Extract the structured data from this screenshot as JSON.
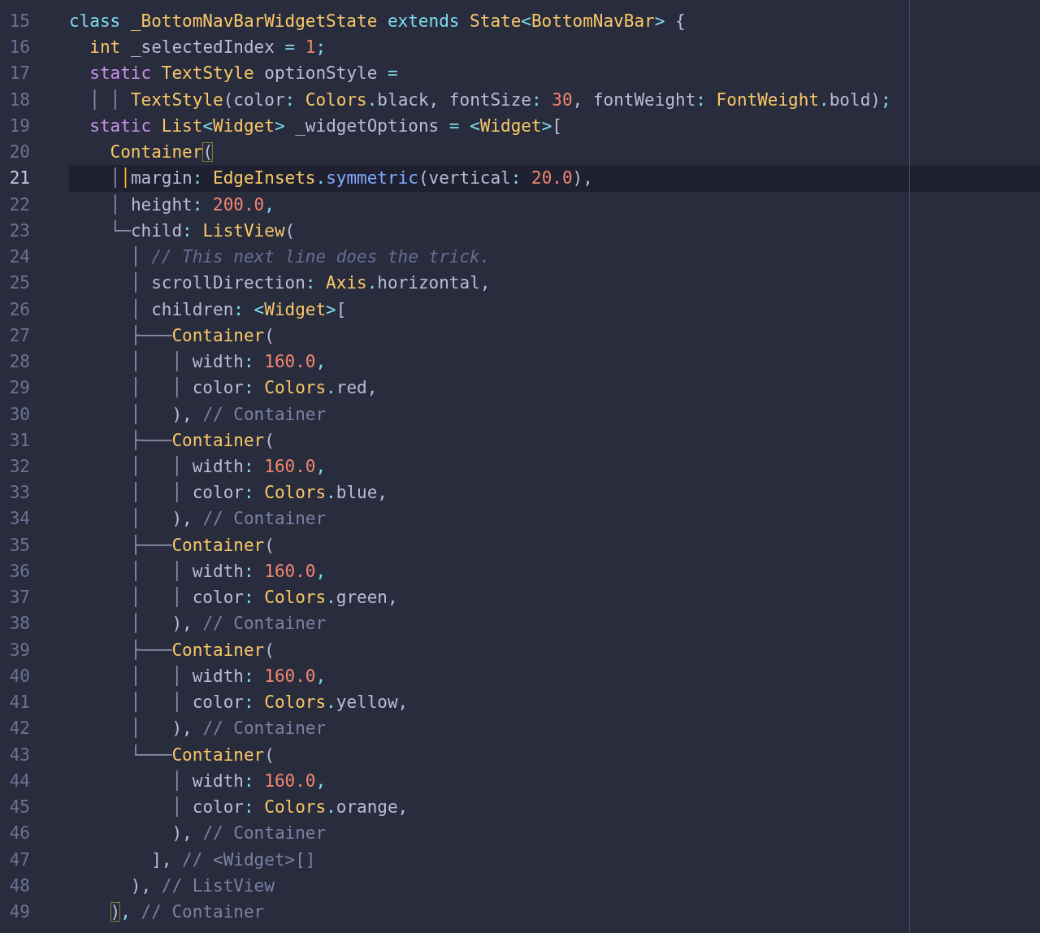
{
  "editor": {
    "lines": [
      {
        "number": "15",
        "current": false,
        "tokens": [
          {
            "text": "class ",
            "kind": "kw"
          },
          {
            "text": "_BottomNavBarWidgetState ",
            "kind": "type"
          },
          {
            "text": "extends ",
            "kind": "kw"
          },
          {
            "text": "State",
            "kind": "type"
          },
          {
            "text": "<",
            "kind": "punct"
          },
          {
            "text": "BottomNavBar",
            "kind": "type"
          },
          {
            "text": "> ",
            "kind": "punct"
          },
          {
            "text": "{",
            "kind": "plain"
          }
        ]
      },
      {
        "number": "16",
        "current": false,
        "tokens": [
          {
            "text": "  int ",
            "kind": "type"
          },
          {
            "text": "_selectedIndex ",
            "kind": "plain"
          },
          {
            "text": "= ",
            "kind": "punct"
          },
          {
            "text": "1",
            "kind": "num"
          },
          {
            "text": ";",
            "kind": "punct"
          }
        ]
      },
      {
        "number": "17",
        "current": false,
        "tokens": [
          {
            "text": "  static ",
            "kind": "storage"
          },
          {
            "text": "TextStyle ",
            "kind": "type"
          },
          {
            "text": "optionStyle ",
            "kind": "plain"
          },
          {
            "text": "=",
            "kind": "punct"
          }
        ]
      },
      {
        "number": "18",
        "current": false,
        "tokens": [
          {
            "text": "  │ │ ",
            "kind": "guide"
          },
          {
            "text": "TextStyle",
            "kind": "type"
          },
          {
            "text": "(color",
            "kind": "plain"
          },
          {
            "text": ": ",
            "kind": "punct"
          },
          {
            "text": "Colors",
            "kind": "type"
          },
          {
            "text": ".",
            "kind": "punct"
          },
          {
            "text": "black, fontSize",
            "kind": "plain"
          },
          {
            "text": ": ",
            "kind": "punct"
          },
          {
            "text": "30",
            "kind": "num"
          },
          {
            "text": ", fontWeight",
            "kind": "plain"
          },
          {
            "text": ": ",
            "kind": "punct"
          },
          {
            "text": "FontWeight",
            "kind": "type"
          },
          {
            "text": ".",
            "kind": "punct"
          },
          {
            "text": "bold)",
            "kind": "plain"
          },
          {
            "text": ";",
            "kind": "punct"
          }
        ]
      },
      {
        "number": "19",
        "current": false,
        "tokens": [
          {
            "text": "  static ",
            "kind": "storage"
          },
          {
            "text": "List",
            "kind": "type"
          },
          {
            "text": "<",
            "kind": "punct"
          },
          {
            "text": "Widget",
            "kind": "type"
          },
          {
            "text": "> ",
            "kind": "punct"
          },
          {
            "text": "_widgetOptions ",
            "kind": "plain"
          },
          {
            "text": "= <",
            "kind": "punct"
          },
          {
            "text": "Widget",
            "kind": "type"
          },
          {
            "text": ">",
            "kind": "punct"
          },
          {
            "text": "[",
            "kind": "plain"
          }
        ]
      },
      {
        "number": "20",
        "current": false,
        "tokens": [
          {
            "text": "    Container",
            "kind": "type"
          },
          {
            "text": "(",
            "kind": "match"
          }
        ]
      },
      {
        "number": "21",
        "current": true,
        "tokens": [
          {
            "text": "    │",
            "kind": "guide"
          },
          {
            "text": "│",
            "kind": "active"
          },
          {
            "text": "margin",
            "kind": "plain"
          },
          {
            "text": ": ",
            "kind": "punct"
          },
          {
            "text": "EdgeInsets",
            "kind": "type"
          },
          {
            "text": ".",
            "kind": "punct"
          },
          {
            "text": "symmetric",
            "kind": "func"
          },
          {
            "text": "(vertical",
            "kind": "plain"
          },
          {
            "text": ": ",
            "kind": "punct"
          },
          {
            "text": "20.0",
            "kind": "num"
          },
          {
            "text": "),",
            "kind": "plain"
          }
        ]
      },
      {
        "number": "22",
        "current": false,
        "tokens": [
          {
            "text": "    │ ",
            "kind": "guide"
          },
          {
            "text": "height",
            "kind": "plain"
          },
          {
            "text": ": ",
            "kind": "punct"
          },
          {
            "text": "200.0",
            "kind": "num"
          },
          {
            "text": ",",
            "kind": "punct"
          }
        ]
      },
      {
        "number": "23",
        "current": false,
        "tokens": [
          {
            "text": "    └─",
            "kind": "guide"
          },
          {
            "text": "child",
            "kind": "plain"
          },
          {
            "text": ": ",
            "kind": "punct"
          },
          {
            "text": "ListView",
            "kind": "type"
          },
          {
            "text": "(",
            "kind": "plain"
          }
        ]
      },
      {
        "number": "24",
        "current": false,
        "tokens": [
          {
            "text": "      │ ",
            "kind": "guide"
          },
          {
            "text": "// This next line does the trick.",
            "kind": "doc"
          }
        ]
      },
      {
        "number": "25",
        "current": false,
        "tokens": [
          {
            "text": "      │ ",
            "kind": "guide"
          },
          {
            "text": "scrollDirection",
            "kind": "plain"
          },
          {
            "text": ": ",
            "kind": "punct"
          },
          {
            "text": "Axis",
            "kind": "type"
          },
          {
            "text": ".",
            "kind": "punct"
          },
          {
            "text": "horizontal,",
            "kind": "plain"
          }
        ]
      },
      {
        "number": "26",
        "current": false,
        "tokens": [
          {
            "text": "      │ ",
            "kind": "guide"
          },
          {
            "text": "children",
            "kind": "plain"
          },
          {
            "text": ": <",
            "kind": "punct"
          },
          {
            "text": "Widget",
            "kind": "type"
          },
          {
            "text": ">",
            "kind": "punct"
          },
          {
            "text": "[",
            "kind": "plain"
          }
        ]
      },
      {
        "number": "27",
        "current": false,
        "tokens": [
          {
            "text": "      ├───",
            "kind": "guide"
          },
          {
            "text": "Container",
            "kind": "type"
          },
          {
            "text": "(",
            "kind": "plain"
          }
        ]
      },
      {
        "number": "28",
        "current": false,
        "tokens": [
          {
            "text": "      │   │ ",
            "kind": "guide"
          },
          {
            "text": "width",
            "kind": "plain"
          },
          {
            "text": ": ",
            "kind": "punct"
          },
          {
            "text": "160.0",
            "kind": "num"
          },
          {
            "text": ",",
            "kind": "punct"
          }
        ]
      },
      {
        "number": "29",
        "current": false,
        "tokens": [
          {
            "text": "      │   │ ",
            "kind": "guide"
          },
          {
            "text": "color",
            "kind": "plain"
          },
          {
            "text": ": ",
            "kind": "punct"
          },
          {
            "text": "Colors",
            "kind": "type"
          },
          {
            "text": ".",
            "kind": "punct"
          },
          {
            "text": "red,",
            "kind": "plain"
          }
        ]
      },
      {
        "number": "30",
        "current": false,
        "tokens": [
          {
            "text": "      │   ",
            "kind": "guide"
          },
          {
            "text": "), ",
            "kind": "plain"
          },
          {
            "text": "// Container",
            "kind": "comment"
          }
        ]
      },
      {
        "number": "31",
        "current": false,
        "tokens": [
          {
            "text": "      ├───",
            "kind": "guide"
          },
          {
            "text": "Container",
            "kind": "type"
          },
          {
            "text": "(",
            "kind": "plain"
          }
        ]
      },
      {
        "number": "32",
        "current": false,
        "tokens": [
          {
            "text": "      │   │ ",
            "kind": "guide"
          },
          {
            "text": "width",
            "kind": "plain"
          },
          {
            "text": ": ",
            "kind": "punct"
          },
          {
            "text": "160.0",
            "kind": "num"
          },
          {
            "text": ",",
            "kind": "punct"
          }
        ]
      },
      {
        "number": "33",
        "current": false,
        "tokens": [
          {
            "text": "      │   │ ",
            "kind": "guide"
          },
          {
            "text": "color",
            "kind": "plain"
          },
          {
            "text": ": ",
            "kind": "punct"
          },
          {
            "text": "Colors",
            "kind": "type"
          },
          {
            "text": ".",
            "kind": "punct"
          },
          {
            "text": "blue,",
            "kind": "plain"
          }
        ]
      },
      {
        "number": "34",
        "current": false,
        "tokens": [
          {
            "text": "      │   ",
            "kind": "guide"
          },
          {
            "text": "), ",
            "kind": "plain"
          },
          {
            "text": "// Container",
            "kind": "comment"
          }
        ]
      },
      {
        "number": "35",
        "current": false,
        "tokens": [
          {
            "text": "      ├───",
            "kind": "guide"
          },
          {
            "text": "Container",
            "kind": "type"
          },
          {
            "text": "(",
            "kind": "plain"
          }
        ]
      },
      {
        "number": "36",
        "current": false,
        "tokens": [
          {
            "text": "      │   │ ",
            "kind": "guide"
          },
          {
            "text": "width",
            "kind": "plain"
          },
          {
            "text": ": ",
            "kind": "punct"
          },
          {
            "text": "160.0",
            "kind": "num"
          },
          {
            "text": ",",
            "kind": "punct"
          }
        ]
      },
      {
        "number": "37",
        "current": false,
        "tokens": [
          {
            "text": "      │   │ ",
            "kind": "guide"
          },
          {
            "text": "color",
            "kind": "plain"
          },
          {
            "text": ": ",
            "kind": "punct"
          },
          {
            "text": "Colors",
            "kind": "type"
          },
          {
            "text": ".",
            "kind": "punct"
          },
          {
            "text": "green,",
            "kind": "plain"
          }
        ]
      },
      {
        "number": "38",
        "current": false,
        "tokens": [
          {
            "text": "      │   ",
            "kind": "guide"
          },
          {
            "text": "), ",
            "kind": "plain"
          },
          {
            "text": "// Container",
            "kind": "comment"
          }
        ]
      },
      {
        "number": "39",
        "current": false,
        "tokens": [
          {
            "text": "      ├───",
            "kind": "guide"
          },
          {
            "text": "Container",
            "kind": "type"
          },
          {
            "text": "(",
            "kind": "plain"
          }
        ]
      },
      {
        "number": "40",
        "current": false,
        "tokens": [
          {
            "text": "      │   │ ",
            "kind": "guide"
          },
          {
            "text": "width",
            "kind": "plain"
          },
          {
            "text": ": ",
            "kind": "punct"
          },
          {
            "text": "160.0",
            "kind": "num"
          },
          {
            "text": ",",
            "kind": "punct"
          }
        ]
      },
      {
        "number": "41",
        "current": false,
        "tokens": [
          {
            "text": "      │   │ ",
            "kind": "guide"
          },
          {
            "text": "color",
            "kind": "plain"
          },
          {
            "text": ": ",
            "kind": "punct"
          },
          {
            "text": "Colors",
            "kind": "type"
          },
          {
            "text": ".",
            "kind": "punct"
          },
          {
            "text": "yellow,",
            "kind": "plain"
          }
        ]
      },
      {
        "number": "42",
        "current": false,
        "tokens": [
          {
            "text": "      │   ",
            "kind": "guide"
          },
          {
            "text": "), ",
            "kind": "plain"
          },
          {
            "text": "// Container",
            "kind": "comment"
          }
        ]
      },
      {
        "number": "43",
        "current": false,
        "tokens": [
          {
            "text": "      └───",
            "kind": "guide"
          },
          {
            "text": "Container",
            "kind": "type"
          },
          {
            "text": "(",
            "kind": "plain"
          }
        ]
      },
      {
        "number": "44",
        "current": false,
        "tokens": [
          {
            "text": "          │ ",
            "kind": "guide"
          },
          {
            "text": "width",
            "kind": "plain"
          },
          {
            "text": ": ",
            "kind": "punct"
          },
          {
            "text": "160.0",
            "kind": "num"
          },
          {
            "text": ",",
            "kind": "punct"
          }
        ]
      },
      {
        "number": "45",
        "current": false,
        "tokens": [
          {
            "text": "          │ ",
            "kind": "guide"
          },
          {
            "text": "color",
            "kind": "plain"
          },
          {
            "text": ": ",
            "kind": "punct"
          },
          {
            "text": "Colors",
            "kind": "type"
          },
          {
            "text": ".",
            "kind": "punct"
          },
          {
            "text": "orange,",
            "kind": "plain"
          }
        ]
      },
      {
        "number": "46",
        "current": false,
        "tokens": [
          {
            "text": "          ), ",
            "kind": "plain"
          },
          {
            "text": "// Container",
            "kind": "comment"
          }
        ]
      },
      {
        "number": "47",
        "current": false,
        "tokens": [
          {
            "text": "        ], ",
            "kind": "plain"
          },
          {
            "text": "// <Widget>[]",
            "kind": "comment"
          }
        ]
      },
      {
        "number": "48",
        "current": false,
        "tokens": [
          {
            "text": "      ), ",
            "kind": "plain"
          },
          {
            "text": "// ListView",
            "kind": "comment"
          }
        ]
      },
      {
        "number": "49",
        "current": false,
        "tokens": [
          {
            "text": "    )",
            "kind": "match"
          },
          {
            "text": ", ",
            "kind": "punct"
          },
          {
            "text": "// Container",
            "kind": "comment"
          }
        ]
      }
    ]
  }
}
